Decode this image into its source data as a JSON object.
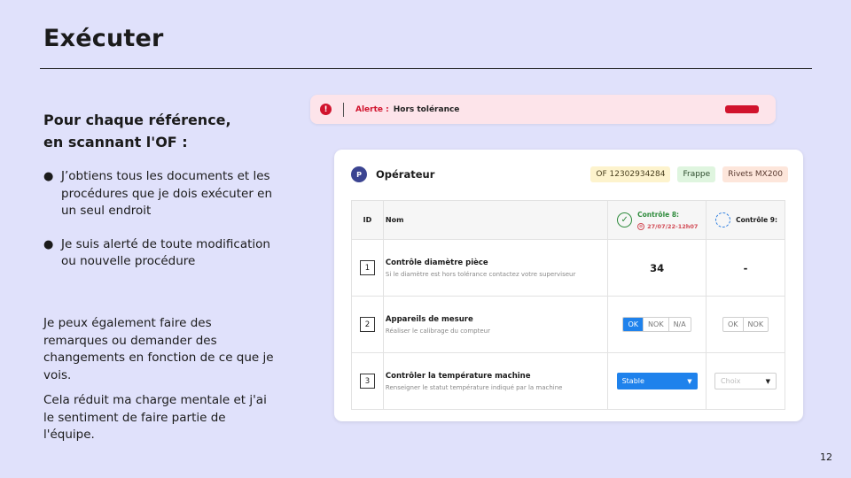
{
  "slide": {
    "title": "Exécuter",
    "subheading_line1": "Pour chaque référence,",
    "subheading_line2": "en scannant l'OF :",
    "bullets": [
      "J’obtiens tous les documents et les procédures que je dois exécuter en un seul endroit",
      "Je suis alerté de toute modification ou nouvelle procédure"
    ],
    "paragraph1": "Je peux également faire des remarques ou demander des changements en fonction de ce que je vois.",
    "paragraph2": "Cela réduit ma charge mentale et j'ai le sentiment de faire partie de l'équipe.",
    "page_number": "12",
    "bullet_glyph": "●"
  },
  "alert": {
    "icon_glyph": "!",
    "label": "Alerte :",
    "text": "Hors tolérance",
    "color": "#d1132d"
  },
  "card": {
    "avatar": "P",
    "title": "Opérateur",
    "tags": {
      "of": "OF 12302934284",
      "frappe": "Frappe",
      "rivets": "Rivets MX200"
    },
    "table": {
      "col_id": "ID",
      "col_name": "Nom",
      "control8": {
        "title": "Contrôle 8:",
        "date": "27/07/22-12h07",
        "status_icon": "check-circle-icon",
        "check_glyph": "✓",
        "date_icon_glyph": "⊝"
      },
      "control9": {
        "title": "Contrôle 9:",
        "status_icon": "pending-circle-icon"
      },
      "rows": [
        {
          "id": "1",
          "title": "Contrôle diamètre pièce",
          "subtitle": "Si le diamètre est hors tolérance contactez votre superviseur",
          "c8_value": "34",
          "c9_value": "-"
        },
        {
          "id": "2",
          "title": "Appareils de mesure",
          "subtitle": "Réaliser le calibrage du compteur",
          "options": [
            "OK",
            "NOK",
            "N/A"
          ],
          "c8_selected": "OK",
          "c9_options": [
            "OK",
            "NOK"
          ]
        },
        {
          "id": "3",
          "title": "Contrôler la température machine",
          "subtitle": "Renseigner le statut température indiqué par la machine",
          "c8_select_value": "Stable",
          "c9_select_placeholder": "Choix",
          "caret_glyph": "▼"
        }
      ]
    }
  },
  "colors": {
    "background": "#e0e1fb",
    "accent_blue": "#1f82ec",
    "success_green": "#2e8b3c",
    "alert_red": "#d1132d"
  }
}
